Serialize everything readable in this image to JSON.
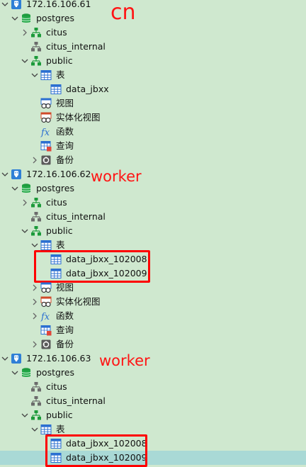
{
  "tree": {
    "servers": [
      {
        "host": "172.16.106.61",
        "annotation": "cn",
        "database": "postgres",
        "schemas": [
          "citus",
          "citus_internal",
          "public"
        ],
        "public_children": {
          "tables_label": "表",
          "tables": [
            "data_jbxx"
          ],
          "views": "视图",
          "materialized_views": "实体化视图",
          "functions": "函数",
          "queries": "查询",
          "backups": "备份"
        }
      },
      {
        "host": "172.16.106.62",
        "annotation": "worker",
        "database": "postgres",
        "schemas": [
          "citus",
          "citus_internal",
          "public"
        ],
        "public_children": {
          "tables_label": "表",
          "tables": [
            "data_jbxx_102008",
            "data_jbxx_102009"
          ],
          "views": "视图",
          "materialized_views": "实体化视图",
          "functions": "函数",
          "queries": "查询",
          "backups": "备份"
        }
      },
      {
        "host": "172.16.106.63",
        "annotation": "worker",
        "database": "postgres",
        "schemas": [
          "citus",
          "citus_internal",
          "public"
        ],
        "public_children": {
          "tables_label": "表",
          "tables": [
            "data_jbxx_102008",
            "data_jbxx_102009"
          ]
        }
      }
    ]
  },
  "colors": {
    "background": "#cfe8cf",
    "selected_row": "#a9d9d6",
    "annotation": "#ff1414",
    "highlight_box": "#ff0000"
  }
}
